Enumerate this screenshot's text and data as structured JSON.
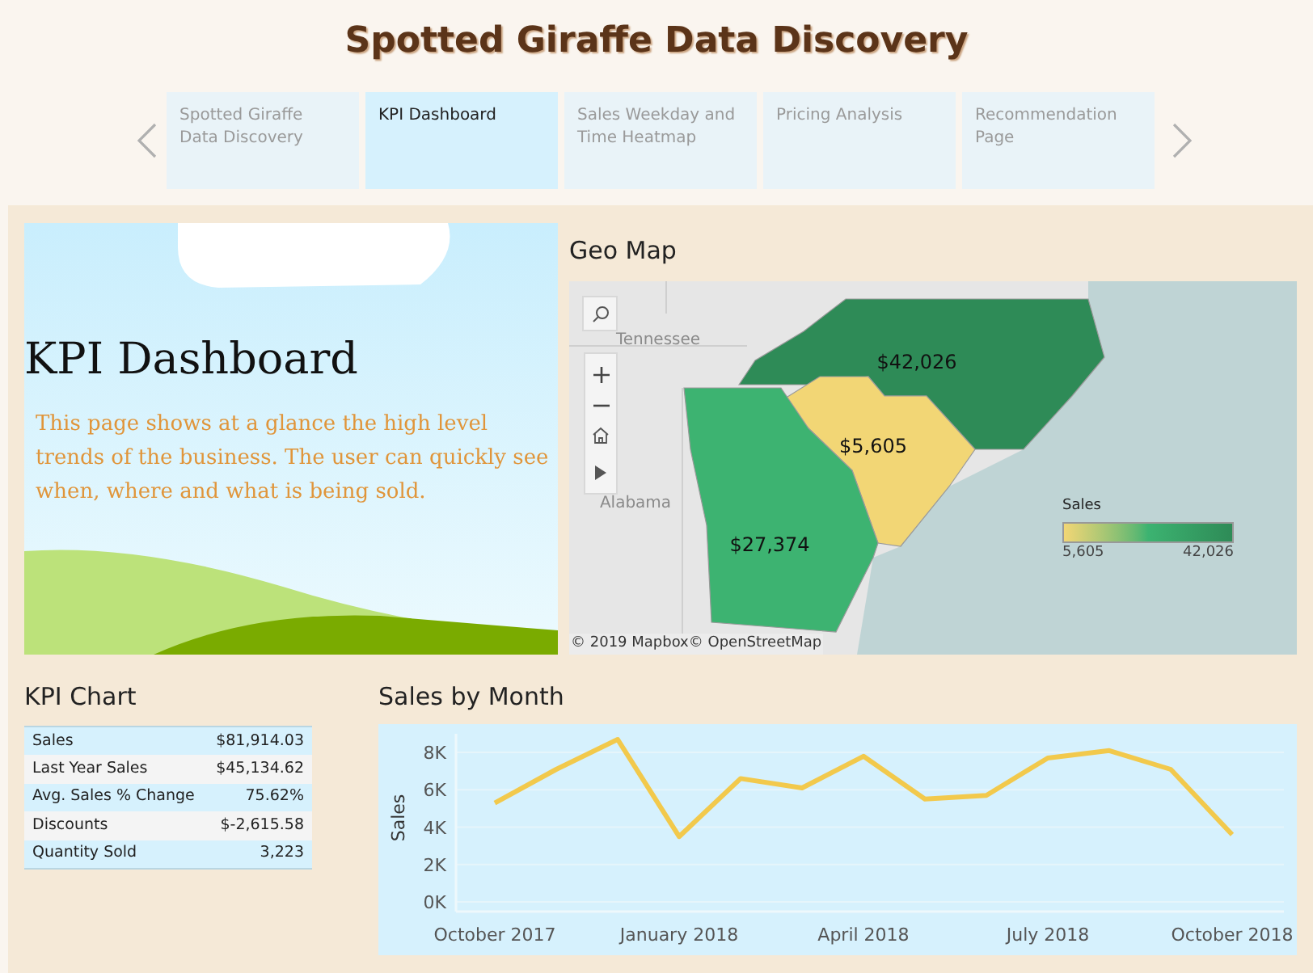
{
  "header": {
    "title": "Spotted Giraffe Data Discovery"
  },
  "tabs": [
    {
      "label": "Spotted Giraffe Data Discovery",
      "selected": false
    },
    {
      "label": "KPI Dashboard",
      "selected": true
    },
    {
      "label": "Sales Weekday and Time Heatmap",
      "selected": false
    },
    {
      "label": "Pricing Analysis",
      "selected": false
    },
    {
      "label": "Recommendation Page",
      "selected": false
    }
  ],
  "hero": {
    "title": "KPI Dashboard",
    "text": "This page shows at a glance the high level trends of the business. The user can quickly see when, where and what is being sold."
  },
  "geo_map": {
    "title": "Geo Map",
    "place_labels": [
      "Tennessee",
      "Alabama"
    ],
    "regions": [
      {
        "value": "$42,026"
      },
      {
        "value": "$5,605"
      },
      {
        "value": "$27,374"
      }
    ],
    "legend": {
      "title": "Sales",
      "min": "5,605",
      "max": "42,026"
    },
    "attribution": "© 2019 Mapbox© OpenStreetMap"
  },
  "kpi_chart": {
    "title": "KPI Chart",
    "rows": [
      {
        "label": "Sales",
        "value": "$81,914.03"
      },
      {
        "label": "Last Year Sales",
        "value": "$45,134.62"
      },
      {
        "label": "Avg. Sales % Change",
        "value": "75.62%"
      },
      {
        "label": "Discounts",
        "value": "$-2,615.58"
      },
      {
        "label": "Quantity Sold",
        "value": "3,223"
      }
    ]
  },
  "sales_by_month": {
    "title": "Sales by Month",
    "chart_data": {
      "type": "line",
      "ylabel": "Sales",
      "grid": true,
      "categories": [
        "October 2017",
        null,
        null,
        "January 2018",
        null,
        null,
        "April 2018",
        null,
        null,
        "July 2018",
        null,
        null,
        "October 2018"
      ],
      "series": [
        {
          "color": "#f2c94c",
          "values": [
            5300,
            7100,
            8700,
            3500,
            6600,
            6100,
            7800,
            5500,
            5700,
            7700,
            8100,
            7100,
            3600
          ]
        }
      ],
      "ylim": [
        0,
        9000
      ],
      "yticks": [
        {
          "value": 0,
          "label": "0K"
        },
        {
          "value": 2000,
          "label": "2K"
        },
        {
          "value": 4000,
          "label": "4K"
        },
        {
          "value": 6000,
          "label": "6K"
        },
        {
          "value": 8000,
          "label": "8K"
        }
      ]
    }
  }
}
